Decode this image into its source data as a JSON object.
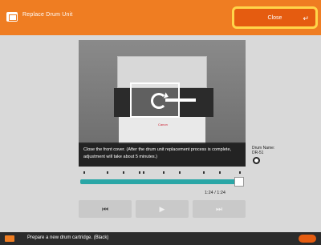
{
  "header": {
    "title": "Replace Drum Unit",
    "close_label": "Close"
  },
  "video": {
    "caption": "Close the front cover. (After the drum unit replacement process is complete, adjustment will take about 5 minutes.)",
    "brand": "Canon"
  },
  "drum": {
    "name_label": "Drum Name:",
    "name_value": "DR-51"
  },
  "playback": {
    "time": "1:24 / 1:24",
    "progress": 1.0,
    "buttons": {
      "restart_icon": "skip-back-icon",
      "play_icon": "play-icon",
      "next_icon": "skip-forward-icon"
    }
  },
  "status_bar": {
    "message": "Prepare a new drum cartridge. (Black)"
  },
  "colors": {
    "accent": "#ef7d22",
    "progress": "#2aa6a6",
    "close_border": "#ffd54a"
  }
}
